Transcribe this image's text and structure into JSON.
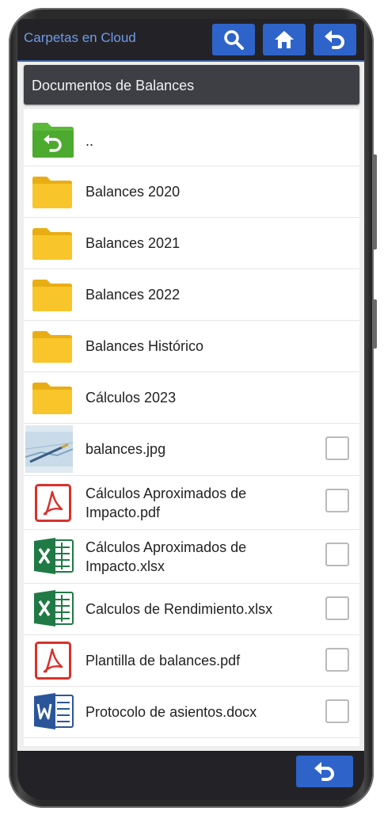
{
  "app": {
    "title": "Carpetas en Cloud"
  },
  "toolbar": {
    "search_icon": "search-icon",
    "home_icon": "home-icon",
    "back_icon": "back-arrow-icon"
  },
  "folder_header": {
    "title": "Documentos de Balances"
  },
  "items": [
    {
      "label": "..",
      "kind": "parent-folder",
      "icon": "folder-up-icon"
    },
    {
      "label": "Balances 2020",
      "kind": "folder",
      "icon": "folder-icon"
    },
    {
      "label": "Balances 2021",
      "kind": "folder",
      "icon": "folder-icon"
    },
    {
      "label": "Balances 2022",
      "kind": "folder",
      "icon": "folder-icon"
    },
    {
      "label": "Balances Histórico",
      "kind": "folder",
      "icon": "folder-icon"
    },
    {
      "label": "Cálculos 2023",
      "kind": "folder",
      "icon": "folder-icon"
    },
    {
      "label": "balances.jpg",
      "kind": "image",
      "icon": "image-thumbnail",
      "checked": false
    },
    {
      "label_line1": "Cálculos Aproximados de",
      "label_line2": "Impacto.pdf",
      "kind": "pdf",
      "icon": "pdf-icon",
      "checked": false
    },
    {
      "label_line1": "Cálculos Aproximados de",
      "label_line2": "Impacto.xlsx",
      "kind": "xlsx",
      "icon": "excel-icon",
      "checked": false
    },
    {
      "label": "Calculos de Rendimiento.xlsx",
      "kind": "xlsx",
      "icon": "excel-icon",
      "checked": false
    },
    {
      "label": "Plantilla de balances.pdf",
      "kind": "pdf",
      "icon": "pdf-icon",
      "checked": false
    },
    {
      "label": "Protocolo de asientos.docx",
      "kind": "docx",
      "icon": "word-icon",
      "checked": false
    }
  ],
  "colors": {
    "accent": "#2e64c9",
    "folder": "#f8c62b",
    "parent_folder": "#5cb83a",
    "pdf": "#d9312b",
    "excel": "#1f7a45",
    "word": "#2a5699"
  },
  "bottom": {
    "back_icon": "back-arrow-icon"
  }
}
